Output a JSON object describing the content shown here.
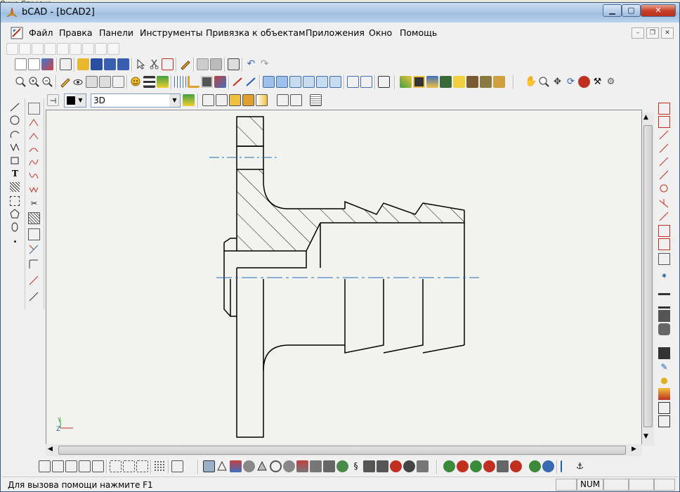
{
  "background_strip": {
    "text": "Окно  Справка"
  },
  "window": {
    "title": "bCAD - [bCAD2]"
  },
  "menu": {
    "items": [
      "Файл",
      "Правка",
      "Панели",
      "Инструменты",
      "Привязка к объектам",
      "Приложения",
      "Окно",
      "Помощь"
    ]
  },
  "properties_bar": {
    "view_mode": "3D",
    "color": "#000000"
  },
  "axis_indicator": {
    "y_label": "Y",
    "z_label": "Z"
  },
  "status": {
    "hint": "Для вызова помощи нажмите F1",
    "num": "NUM"
  },
  "colors": {
    "accent_blue": "#1e6fb8",
    "canvas": "#f2f2ee",
    "title_bar": "#a9c6e6",
    "close_red": "#c8412b"
  }
}
